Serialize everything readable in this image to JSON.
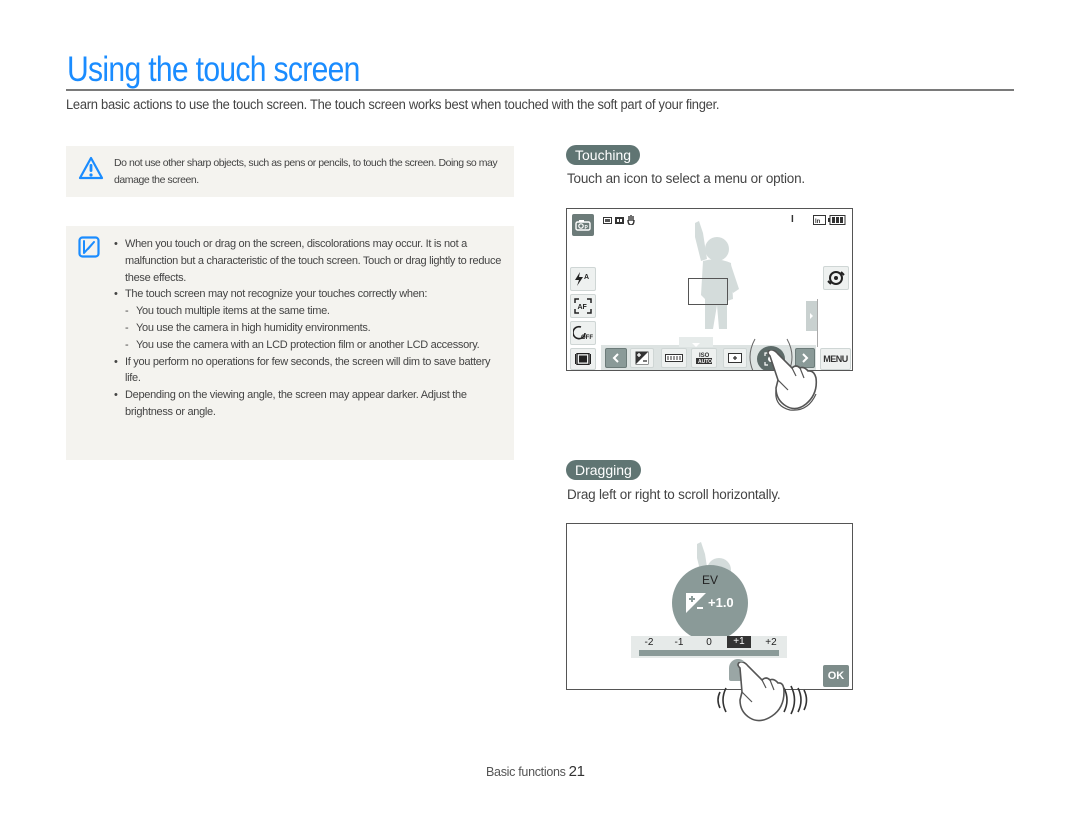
{
  "page": {
    "title": "Using the touch screen",
    "intro": "Learn basic actions to use the touch screen. The touch screen works best when touched with the soft part of your finger."
  },
  "caution": {
    "icon": "warning-triangle-icon",
    "text": "Do not use other sharp objects, such as pens or pencils, to touch the screen. Doing so may damage the screen."
  },
  "note": {
    "icon": "note-pencil-icon",
    "items": [
      {
        "type": "bullet",
        "text": "When you touch or drag on the screen, discolorations may occur. It is not a malfunction but a characteristic of the touch screen. Touch or drag lightly to reduce these effects."
      },
      {
        "type": "bullet",
        "text": "The touch screen may not recognize your touches correctly when:"
      },
      {
        "type": "sub",
        "text": "You touch multiple items at the same time."
      },
      {
        "type": "sub",
        "text": "You use the camera in high humidity environments."
      },
      {
        "type": "sub",
        "text": "You use the camera with an LCD protection film or another LCD accessory."
      },
      {
        "type": "bullet",
        "text": "If you perform no operations for few seconds, the screen will dim to save battery life."
      },
      {
        "type": "bullet",
        "text": "Depending on the viewing angle, the screen may appear darker. Adjust the brightness or angle."
      }
    ]
  },
  "touching": {
    "label": "Touching",
    "description": "Touch an icon to select a menu or option.",
    "screen": {
      "mode_icon": "camera-program-icon",
      "status_icons": [
        "image-size-icon",
        "quality-icon",
        "stabilizer-hand-icon"
      ],
      "shot_count": "I",
      "storage_icon": "internal-memory-icon",
      "battery_icon": "battery-full-icon",
      "left_buttons": [
        "flash-auto-icon",
        "autofocus-icon",
        "timer-off-icon",
        "display-icon"
      ],
      "right_buttons": [
        "dual-is-icon"
      ],
      "menu_label": "MENU",
      "strip_buttons": [
        "prev-icon",
        "ev-icon",
        "white-balance-icon",
        "iso-auto-icon",
        "metering-icon",
        "face-detect-icon",
        "next-icon"
      ]
    }
  },
  "dragging": {
    "label": "Dragging",
    "description": "Drag left or right to scroll horizontally.",
    "screen": {
      "ev_title": "EV",
      "ev_value": "+1.0",
      "scale_labels": [
        "-2",
        "-1",
        "0",
        "+1",
        "+2"
      ],
      "selected_label": "+1",
      "ok_label": "OK"
    }
  },
  "footer": {
    "section": "Basic functions",
    "page_number": "21"
  },
  "colors": {
    "title_blue": "#1a8cff",
    "pill_gray": "#607573",
    "box_bg": "#f4f3ef"
  }
}
